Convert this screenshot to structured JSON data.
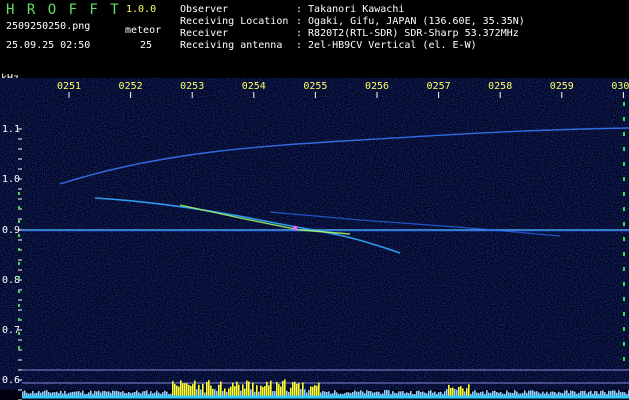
{
  "header": {
    "app_name": "H R O F F T",
    "app_version": "1.0.0",
    "filename": "2509250250.png",
    "datetime": "25.09.25 02:50",
    "meteor_label": "meteor",
    "meteor_count": "25",
    "info_labels": [
      "Observer",
      "Receiving Location",
      "Receiver",
      "Receiving antenna"
    ],
    "info_values": [
      ": Takanori Kawachi",
      ": Ogaki, Gifu, JAPAN (136.60E, 35.35N)",
      ": R820T2(RTL-SDR) SDR-Sharp 53.372MHz",
      ": 2el-HB9CV Vertical (el. E-W)"
    ]
  },
  "axis": {
    "unit": "kHz",
    "y_ticks": [
      "1.1",
      "1.0",
      "0.9",
      "0.8",
      "0.7",
      "0.6"
    ],
    "x_ticks": [
      "0251",
      "0252",
      "0253",
      "0254",
      "0255",
      "0256",
      "0257",
      "0258",
      "0259",
      "0300"
    ]
  },
  "colors": {
    "background": "#000000",
    "header_text": "#ffffff",
    "app_title": "#66dd66",
    "version": "#ffff66",
    "tick_labels": "#ffff66",
    "grid_labels": "#ffffff",
    "noise": "#0a1a8a",
    "trace": "#33aaff",
    "meteor_head": "#aaff66",
    "level_bars": "#ffff33",
    "baseline": "#33ccff"
  }
}
